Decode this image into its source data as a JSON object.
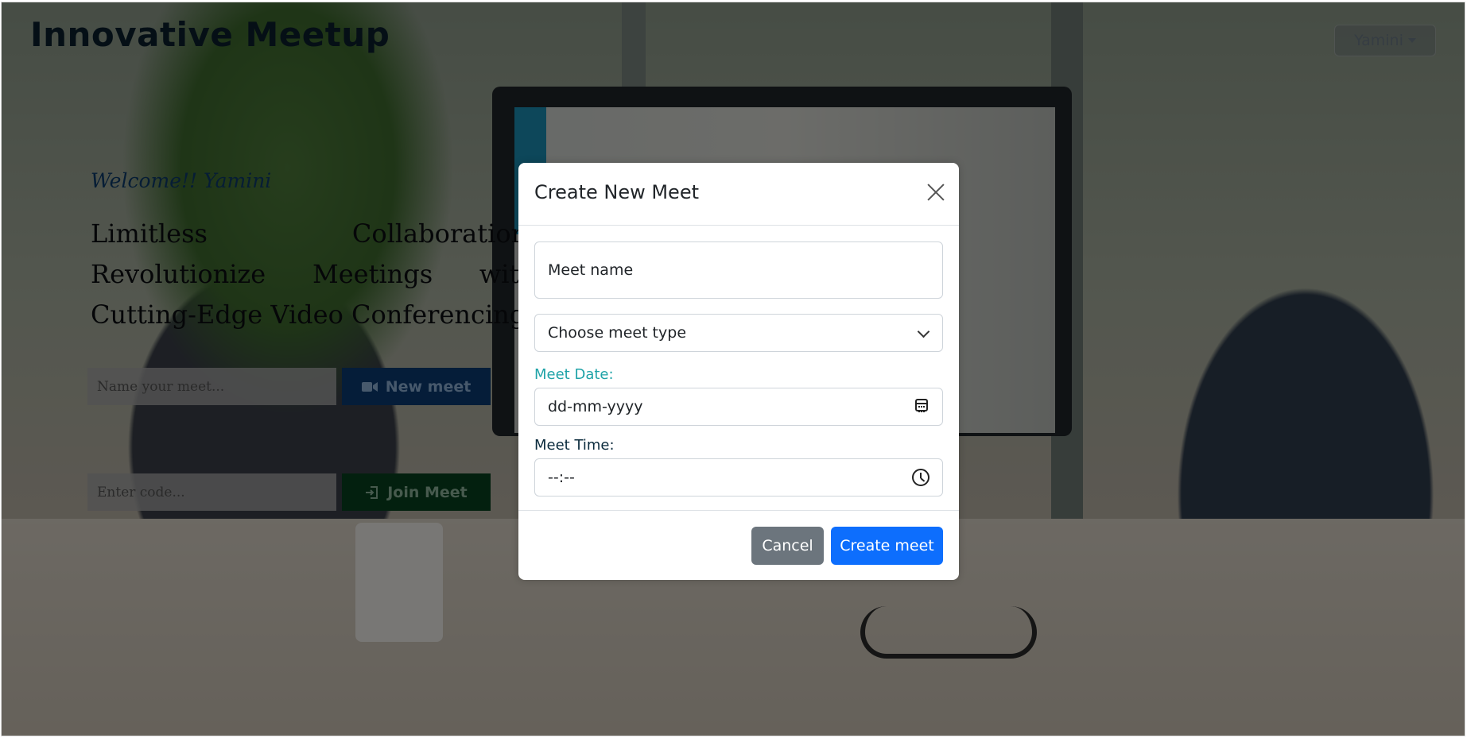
{
  "header": {
    "brand": "Innovative Meetup",
    "user_menu_label": "Yamini"
  },
  "hero": {
    "welcome": "Welcome!! Yamini",
    "tagline": "Limitless Collaboration: Revolutionize Meetings with Cutting-Edge Video Conferencing"
  },
  "actions": {
    "name_placeholder": "Name your meet...",
    "new_meet_label": "New meet",
    "code_placeholder": "Enter code...",
    "join_meet_label": "Join Meet"
  },
  "modal": {
    "title": "Create New Meet",
    "meet_name_placeholder": "Meet name",
    "meet_type_selected": "Choose meet type",
    "date_label": "Meet Date:",
    "date_value": "dd-mm-yyyy",
    "time_label": "Meet Time:",
    "time_value": "--:--",
    "cancel_label": "Cancel",
    "create_label": "Create meet"
  },
  "icons": {
    "new_meet_icon": "video-camera-icon",
    "join_icon": "enter-icon",
    "close_icon": "close-icon",
    "calendar_icon": "calendar-icon",
    "clock_icon": "clock-icon"
  },
  "colors": {
    "primary": "#0d6efd",
    "secondary": "#6c757d",
    "date_label": "#1fa3a8",
    "time_label": "#0b2b3d"
  }
}
